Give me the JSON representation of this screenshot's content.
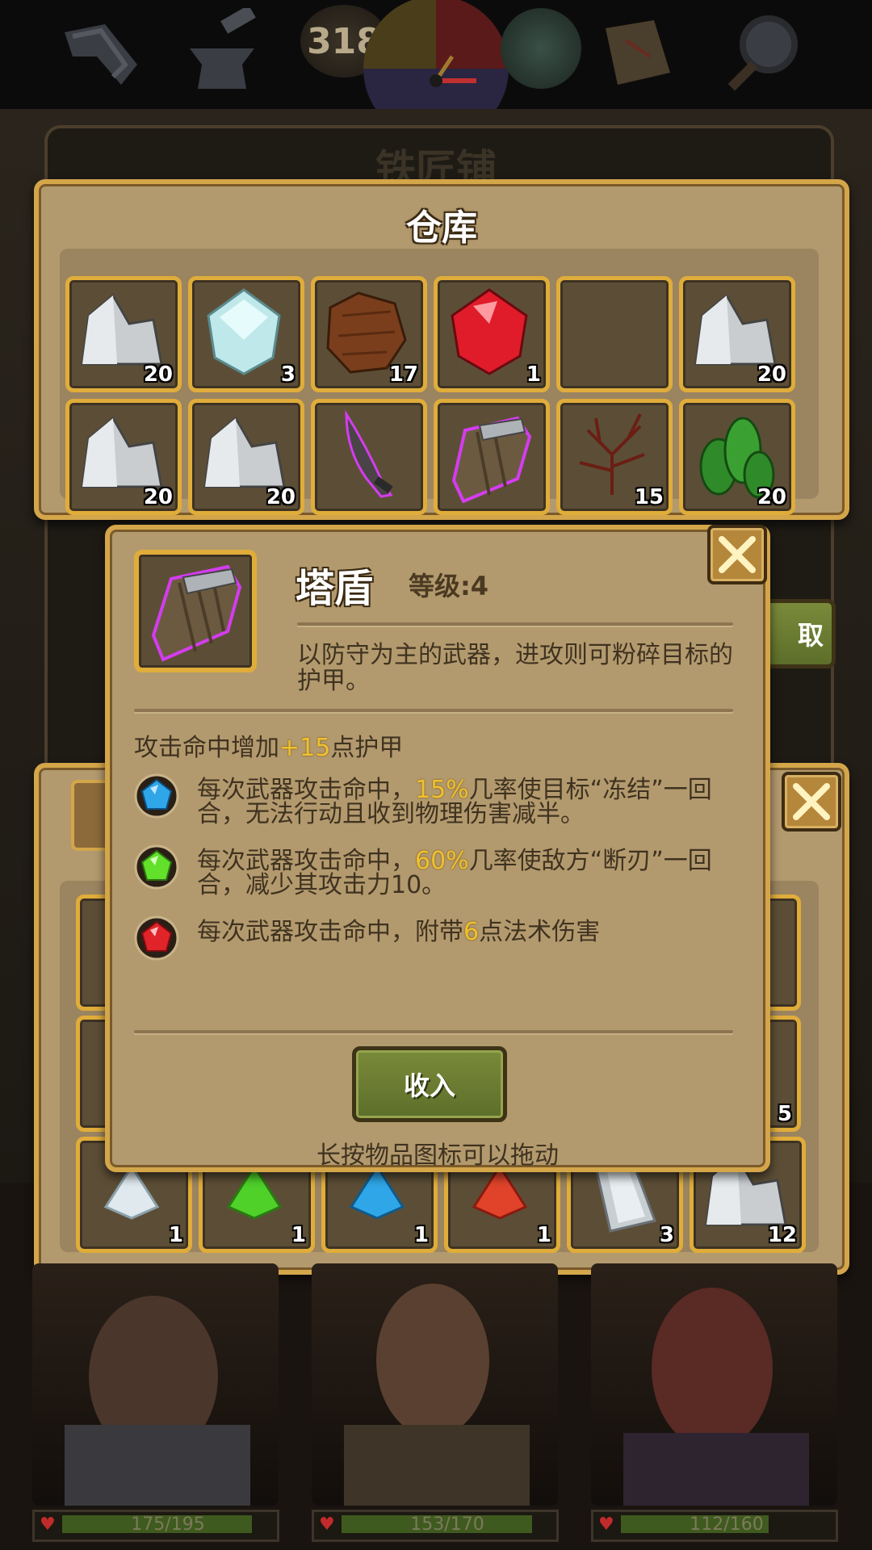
{
  "topbar": {
    "day": "318",
    "icons": [
      "crafting-icon",
      "anvil-icon",
      "sun-moon-clock-icon",
      "weather-icon",
      "map-icon",
      "magnifier-icon"
    ]
  },
  "background": {
    "shop_title": "铁匠铺",
    "take_label": "取"
  },
  "warehouse": {
    "title": "仓库",
    "slots": [
      {
        "item": "iron-ore",
        "count": "20"
      },
      {
        "item": "diamond",
        "count": "3"
      },
      {
        "item": "leather",
        "count": "17"
      },
      {
        "item": "ruby",
        "count": "1"
      },
      {
        "item": "empty",
        "count": ""
      },
      {
        "item": "iron-ore",
        "count": "20"
      },
      {
        "item": "iron-ore",
        "count": "20"
      },
      {
        "item": "iron-ore",
        "count": "20"
      },
      {
        "item": "dagger",
        "count": ""
      },
      {
        "item": "tower-shield",
        "count": ""
      },
      {
        "item": "twigs",
        "count": "15"
      },
      {
        "item": "cactus-herb",
        "count": "20"
      }
    ]
  },
  "lower_panel": {
    "bottom_row": [
      {
        "item": "white-gem",
        "count": "1"
      },
      {
        "item": "green-gem",
        "count": "1"
      },
      {
        "item": "blue-gem",
        "count": "1"
      },
      {
        "item": "red-gem",
        "count": "1"
      },
      {
        "item": "iron-ingot",
        "count": "3"
      },
      {
        "item": "iron-ore",
        "count": "12"
      }
    ],
    "right_count": "5"
  },
  "detail": {
    "name": "塔盾",
    "level": "等级:4",
    "description": "以防守为主的武器，进攻则可粉碎目标的护甲。",
    "bonus_prefix": "攻击命中增加",
    "bonus_value": "+15",
    "bonus_suffix": "点护甲",
    "effects": [
      {
        "gem": "blue",
        "pre": "每次武器攻击命中，",
        "value": "15%",
        "post": "几率使目标“冻结”一回合，无法行动且收到物理伤害减半。"
      },
      {
        "gem": "green",
        "pre": "每次武器攻击命中，",
        "value": "60%",
        "post": "几率使敌方“断刃”一回合，减少其攻击力10。"
      },
      {
        "gem": "red",
        "pre": "每次武器攻击命中，附带",
        "value": "6",
        "post": "点法术伤害"
      }
    ],
    "store_button": "收入",
    "hint": "长按物品图标可以拖动"
  },
  "heroes": [
    {
      "hp": "175/195",
      "fill": 0.897
    },
    {
      "hp": "153/170",
      "fill": 0.9
    },
    {
      "hp": "112/160",
      "fill": 0.7
    }
  ],
  "colors": {
    "gold_border": "#e0ad3a",
    "panel": "#b39a6e",
    "highlight": "#f0c12f",
    "button_green": "#6b7c32"
  }
}
